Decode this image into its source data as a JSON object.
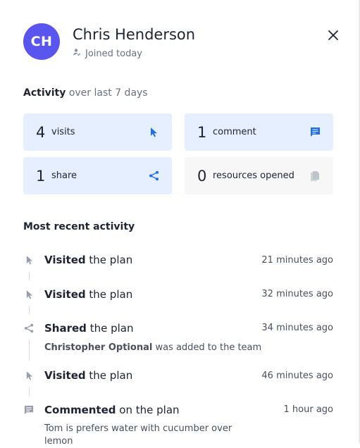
{
  "profile": {
    "initials": "CH",
    "name": "Chris Henderson",
    "joined": "Joined today",
    "avatar_color": "#5b55ef"
  },
  "activity_summary": {
    "title_bold": "Activity",
    "title_rest": "over last 7 days",
    "cards": [
      {
        "count": "4",
        "label": "visits",
        "icon": "cursor-icon"
      },
      {
        "count": "1",
        "label": "comment",
        "icon": "comment-icon"
      },
      {
        "count": "1",
        "label": "share",
        "icon": "share-icon"
      },
      {
        "count": "0",
        "label": "resources opened",
        "icon": "copy-icon"
      }
    ],
    "accent_color": "#1f6fe5"
  },
  "recent": {
    "title": "Most recent activity",
    "items": [
      {
        "action": "Visited",
        "rest": "the plan",
        "time": "21 minutes ago",
        "icon": "cursor-icon"
      },
      {
        "action": "Visited",
        "rest": "the plan",
        "time": "32 minutes ago",
        "icon": "cursor-icon"
      },
      {
        "action": "Shared",
        "rest": "the plan",
        "time": "34 minutes ago",
        "icon": "share-icon",
        "detail_bold": "Christopher Optional",
        "detail_rest": "was added to the team"
      },
      {
        "action": "Visited",
        "rest": "the plan",
        "time": "46 minutes ago",
        "icon": "cursor-icon"
      },
      {
        "action": "Commented",
        "rest": "on the plan",
        "time": "1 hour ago",
        "icon": "comment-icon",
        "comment": "Tom is prefers water with cucumber over lemon"
      }
    ]
  }
}
